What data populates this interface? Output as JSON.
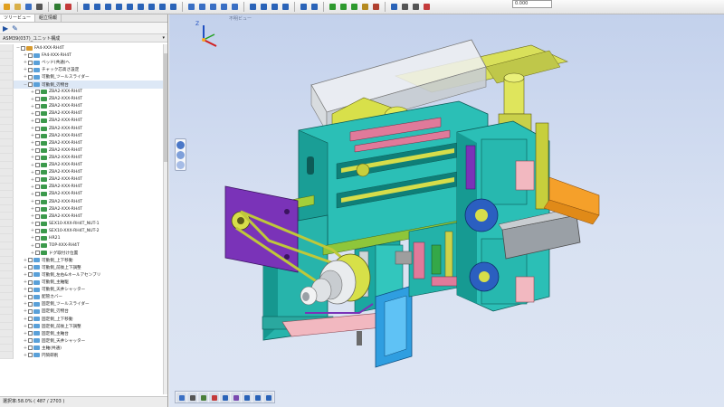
{
  "toolbar": {
    "input_value": "0.000",
    "groups": [
      {
        "icons": [
          {
            "name": "new-file-icon",
            "color": "#e0a020"
          },
          {
            "name": "open-folder-icon",
            "color": "#d9b04a"
          },
          {
            "name": "save-icon",
            "color": "#3a6fc4"
          },
          {
            "name": "print-icon",
            "color": "#555555"
          }
        ]
      },
      {
        "icons": [
          {
            "name": "select-icon",
            "color": "#2f7d32"
          },
          {
            "name": "measure-icon",
            "color": "#c43a3a"
          }
        ]
      },
      {
        "icons": [
          {
            "name": "zoom-fit-icon",
            "color": "#2a63b8"
          },
          {
            "name": "rotate-icon",
            "color": "#2a63b8"
          },
          {
            "name": "pan-icon",
            "color": "#2a63b8"
          },
          {
            "name": "zoom-in-icon",
            "color": "#2a63b8"
          },
          {
            "name": "zoom-out-icon",
            "color": "#2a63b8"
          },
          {
            "name": "zoom-window-icon",
            "color": "#2a63b8"
          },
          {
            "name": "magnifier-icon",
            "color": "#2a63b8"
          },
          {
            "name": "view-prev-icon",
            "color": "#2a63b8"
          },
          {
            "name": "view-next-icon",
            "color": "#2a63b8"
          }
        ]
      },
      {
        "icons": [
          {
            "name": "view-front-icon",
            "color": "#3a6fc4"
          },
          {
            "name": "view-top-icon",
            "color": "#3a6fc4"
          },
          {
            "name": "view-right-icon",
            "color": "#3a6fc4"
          },
          {
            "name": "view-iso-icon",
            "color": "#3a6fc4"
          },
          {
            "name": "view-back-icon",
            "color": "#3a6fc4"
          }
        ]
      },
      {
        "icons": [
          {
            "name": "shaded-icon",
            "color": "#2a63b8"
          },
          {
            "name": "wireframe-icon",
            "color": "#2a63b8"
          },
          {
            "name": "hidden-line-icon",
            "color": "#2a63b8"
          },
          {
            "name": "transparent-icon",
            "color": "#2a63b8"
          }
        ]
      },
      {
        "icons": [
          {
            "name": "undo-icon",
            "color": "#2a63b8"
          },
          {
            "name": "redo-icon",
            "color": "#2a63b8"
          }
        ]
      },
      {
        "icons": [
          {
            "name": "green-cylinder-1-icon",
            "color": "#2e9a2e"
          },
          {
            "name": "green-cylinder-2-icon",
            "color": "#2e9a2e"
          },
          {
            "name": "green-cylinder-3-icon",
            "color": "#2e9a2e"
          },
          {
            "name": "gear-icon",
            "color": "#b58a20"
          },
          {
            "name": "tool-icon",
            "color": "#b04030"
          }
        ]
      },
      {
        "icons": [
          {
            "name": "coordinate-icon",
            "color": "#2a63b8"
          },
          {
            "name": "axis-icon",
            "color": "#555555"
          },
          {
            "name": "cross-icon",
            "color": "#555555"
          },
          {
            "name": "crosshair-icon",
            "color": "#c43a3a"
          }
        ]
      }
    ]
  },
  "panel": {
    "tabs": [
      "ツリービュー",
      "組立情報"
    ],
    "tool_icons": [
      "▶",
      "✎"
    ],
    "filter_text": "ASM39(037)_ユニット構成",
    "status_text": "選択率:58.0% ( 487 / 2703 )",
    "tree": [
      {
        "label": "FA4-XXX-RH4T",
        "level": 0,
        "icon": "#d89a2e",
        "expander": "−"
      },
      {
        "label": "FA4-XXX-RH4T",
        "level": 1,
        "icon": "#5aa0d8",
        "expander": "+"
      },
      {
        "label": "ベッド(共通)へ",
        "level": 1,
        "icon": "#5aa0d8",
        "expander": "+"
      },
      {
        "label": "チャック芯高さ設定",
        "level": 1,
        "icon": "#5aa0d8",
        "expander": "+"
      },
      {
        "label": "可動側_ツールスライダー",
        "level": 1,
        "icon": "#5aa0d8",
        "expander": "+"
      },
      {
        "label": "可動側_刃物台",
        "level": 1,
        "icon": "#5aa0d8",
        "expander": "−",
        "selected": true
      },
      {
        "label": "ZBA2-XXX-RH4T",
        "level": 2,
        "icon": "#3c9a4c",
        "expander": "+"
      },
      {
        "label": "ZBA2-XXX-RH4T",
        "level": 2,
        "icon": "#3c9a4c",
        "expander": "+"
      },
      {
        "label": "ZBA2-XXX-RH4T",
        "level": 2,
        "icon": "#3c9a4c",
        "expander": "+"
      },
      {
        "label": "ZBA2-XXX-RH4T",
        "level": 2,
        "icon": "#3c9a4c",
        "expander": "+"
      },
      {
        "label": "ZBA2-XXX-RH4T",
        "level": 2,
        "icon": "#3c9a4c",
        "expander": "+"
      },
      {
        "label": "ZBA2-XXX-RH4T",
        "level": 2,
        "icon": "#3c9a4c",
        "expander": "+"
      },
      {
        "label": "ZBA2-XXX-RH4T",
        "level": 2,
        "icon": "#3c9a4c",
        "expander": "+"
      },
      {
        "label": "ZBA2-XXX-RH4T",
        "level": 2,
        "icon": "#3c9a4c",
        "expander": "+"
      },
      {
        "label": "ZBA2-XXX-RH4T",
        "level": 2,
        "icon": "#3c9a4c",
        "expander": "+"
      },
      {
        "label": "ZBA2-XXX-RH4T",
        "level": 2,
        "icon": "#3c9a4c",
        "expander": "+"
      },
      {
        "label": "ZBA2-XXX-RH4T",
        "level": 2,
        "icon": "#3c9a4c",
        "expander": "+"
      },
      {
        "label": "ZBA2-XXX-RH4T",
        "level": 2,
        "icon": "#3c9a4c",
        "expander": "+"
      },
      {
        "label": "ZBA2-XXX-RH4T",
        "level": 2,
        "icon": "#3c9a4c",
        "expander": "+"
      },
      {
        "label": "ZBA2-XXX-RH4T",
        "level": 2,
        "icon": "#3c9a4c",
        "expander": "+"
      },
      {
        "label": "ZBA2-XXX-RH4T",
        "level": 2,
        "icon": "#3c9a4c",
        "expander": "+"
      },
      {
        "label": "ZBA2-XXX-RH4T",
        "level": 2,
        "icon": "#3c9a4c",
        "expander": "+"
      },
      {
        "label": "ZBA2-XXX-RH4T",
        "level": 2,
        "icon": "#3c9a4c",
        "expander": "+"
      },
      {
        "label": "ZBA2-XXX-RH4T",
        "level": 2,
        "icon": "#3c9a4c",
        "expander": "+"
      },
      {
        "label": "SEX10-XXX-RH4T_NUT-1",
        "level": 2,
        "icon": "#3c9a4c",
        "expander": "+"
      },
      {
        "label": "SEX10-XXX-RH4T_NUT-2",
        "level": 2,
        "icon": "#3c9a4c",
        "expander": "+"
      },
      {
        "label": "HR21",
        "level": 2,
        "icon": "#3c9a4c",
        "expander": "+"
      },
      {
        "label": "TOP-XXX-RH4T",
        "level": 2,
        "icon": "#3c9a4c",
        "expander": "+"
      },
      {
        "label": "ドグ取付け位置",
        "level": 2,
        "icon": "#3c9a4c",
        "expander": "+"
      },
      {
        "label": "可動側_上下移動",
        "level": 1,
        "icon": "#5aa0d8",
        "expander": "+"
      },
      {
        "label": "可動側_前後上下調整",
        "level": 1,
        "icon": "#5aa0d8",
        "expander": "+"
      },
      {
        "label": "可動側_左右&ネールアセンブリ",
        "level": 1,
        "icon": "#5aa0d8",
        "expander": "+"
      },
      {
        "label": "可動側_主軸駆",
        "level": 1,
        "icon": "#5aa0d8",
        "expander": "+"
      },
      {
        "label": "可動側_天井シャッター",
        "level": 1,
        "icon": "#5aa0d8",
        "expander": "+"
      },
      {
        "label": "配管カバー",
        "level": 1,
        "icon": "#5aa0d8",
        "expander": "+"
      },
      {
        "label": "固定側_ツールスライダー",
        "level": 1,
        "icon": "#5aa0d8",
        "expander": "+"
      },
      {
        "label": "固定側_刃物台",
        "level": 1,
        "icon": "#5aa0d8",
        "expander": "+"
      },
      {
        "label": "固定側_上下移動",
        "level": 1,
        "icon": "#5aa0d8",
        "expander": "+"
      },
      {
        "label": "固定側_前後上下調整",
        "level": 1,
        "icon": "#5aa0d8",
        "expander": "+"
      },
      {
        "label": "固定側_主軸台",
        "level": 1,
        "icon": "#5aa0d8",
        "expander": "+"
      },
      {
        "label": "固定側_天井シャッター",
        "level": 1,
        "icon": "#5aa0d8",
        "expander": "+"
      },
      {
        "label": "主軸(共通)",
        "level": 1,
        "icon": "#5aa0d8",
        "expander": "+"
      },
      {
        "label": "円筒研削",
        "level": 1,
        "icon": "#5aa0d8",
        "expander": "+"
      }
    ]
  },
  "viewport": {
    "label": "不明ビュー",
    "model": "machine-tool-assembly-3d",
    "side_controls": [
      {
        "name": "rotate-ball-icon",
        "color": "#4b78c8"
      },
      {
        "name": "pan-ball-icon",
        "color": "#7fa0da"
      },
      {
        "name": "zoom-ball-icon",
        "color": "#a6bce6"
      }
    ],
    "bottom_tools": [
      {
        "name": "snap-icon",
        "color": "#3a6fc4"
      },
      {
        "name": "select-box-icon",
        "color": "#555555"
      },
      {
        "name": "measure-distance-icon",
        "color": "#4a7f3a"
      },
      {
        "name": "section-icon",
        "color": "#c43a3a"
      },
      {
        "name": "move-part-icon",
        "color": "#2a63b8"
      },
      {
        "name": "explode-icon",
        "color": "#7a4ab0"
      },
      {
        "name": "clip-plane-icon",
        "color": "#2a63b8"
      },
      {
        "name": "annotate-icon",
        "color": "#2a63b8"
      },
      {
        "name": "check-icon",
        "color": "#2a63b8"
      }
    ]
  }
}
